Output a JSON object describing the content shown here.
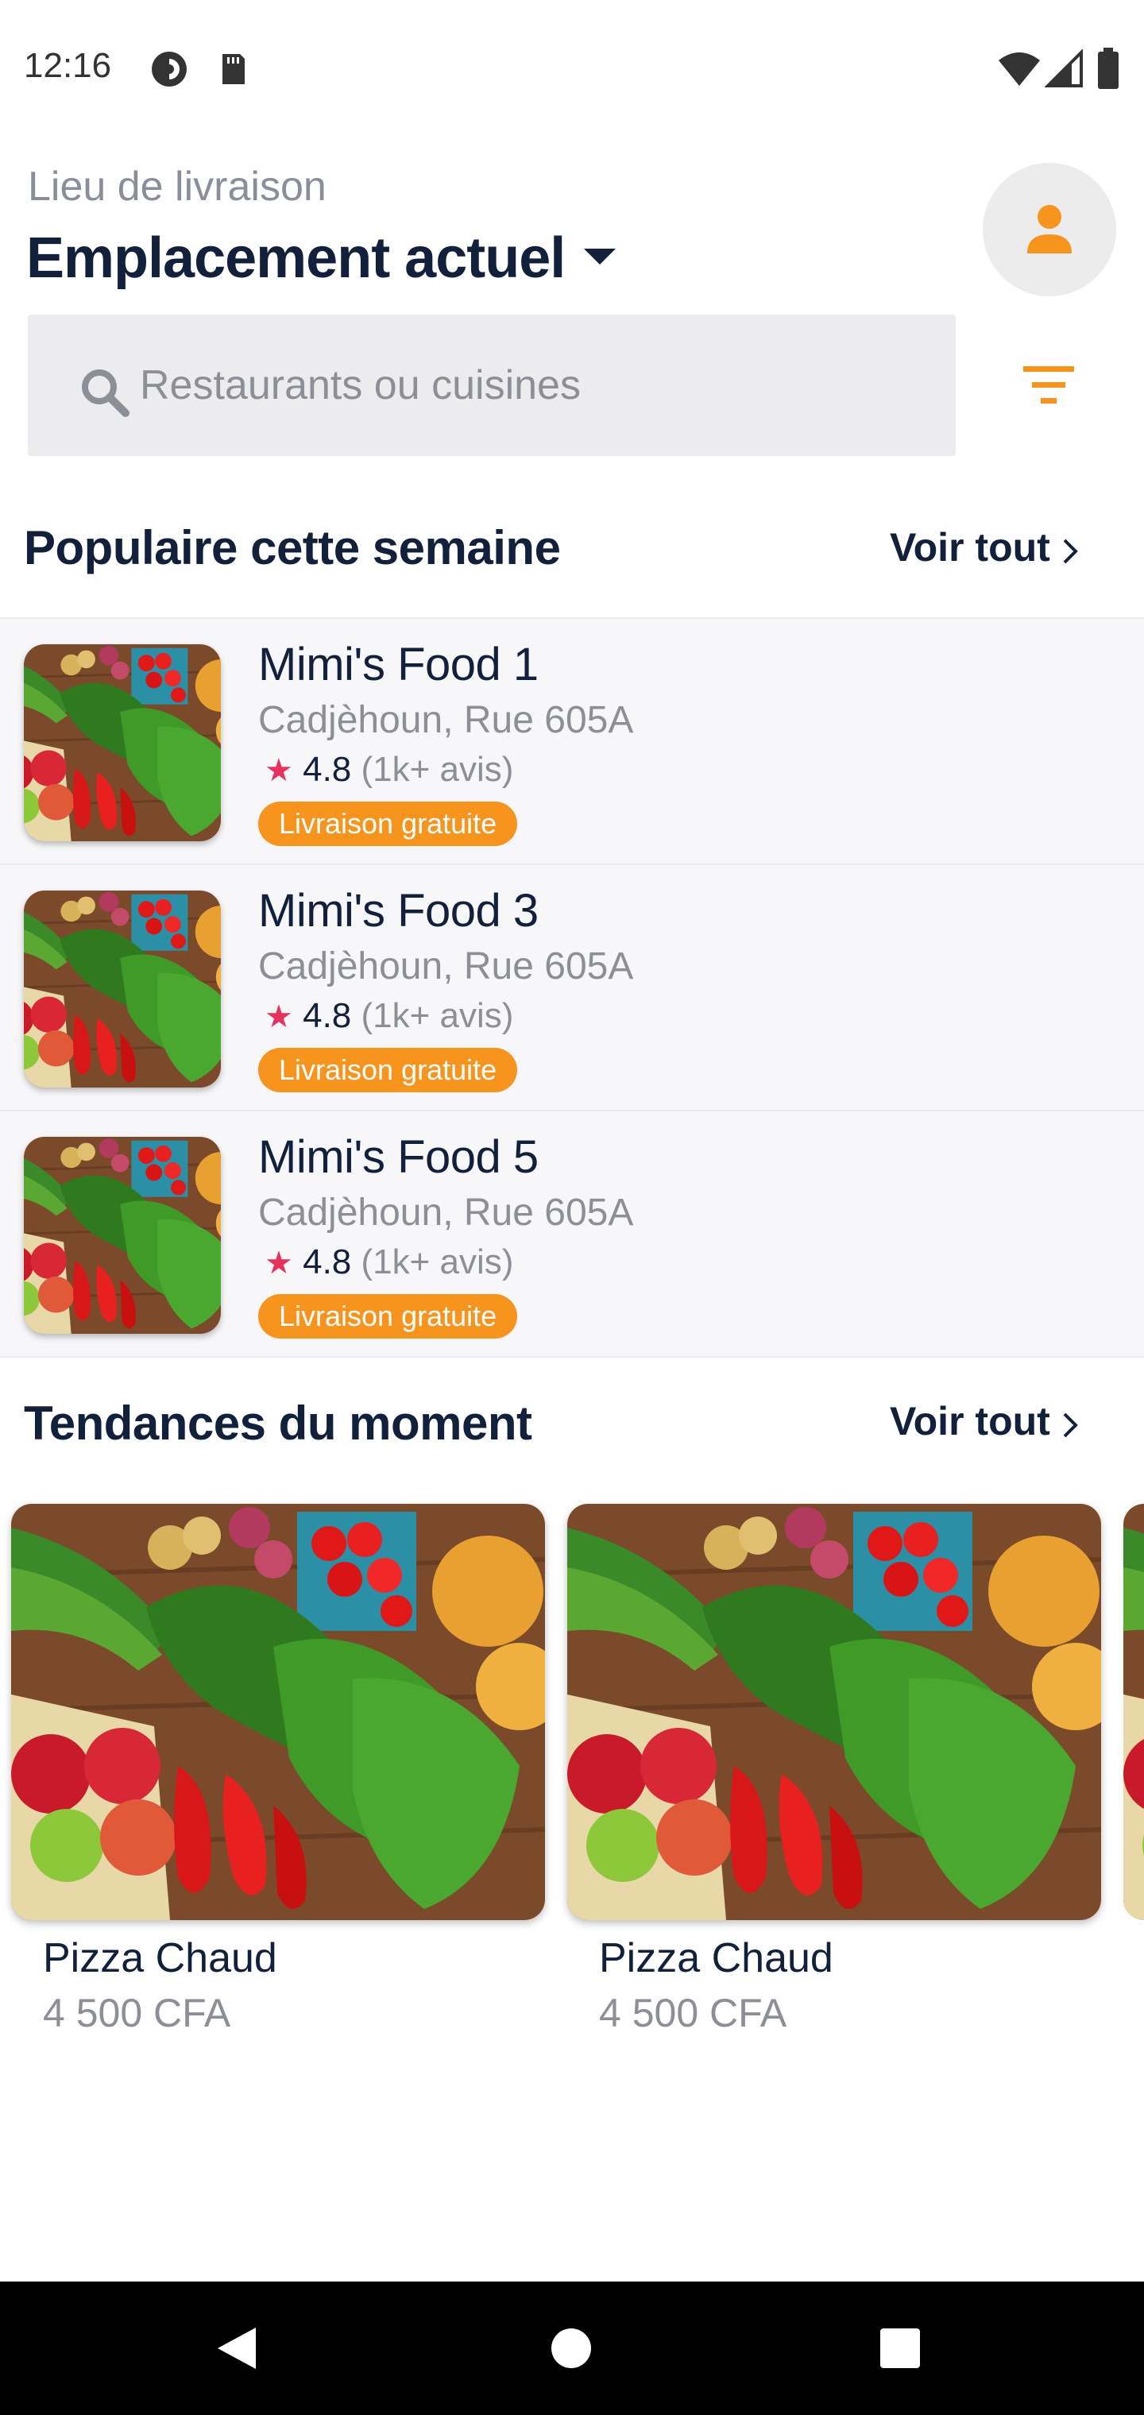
{
  "status_bar": {
    "time": "12:16"
  },
  "header": {
    "location_label": "Lieu de livraison",
    "location_title": "Emplacement actuel",
    "search_placeholder": "Restaurants ou cuisines"
  },
  "popular": {
    "title": "Populaire cette semaine",
    "see_all": "Voir tout",
    "items": [
      {
        "name": "Mimi's Food 1",
        "address": "Cadjèhoun, Rue 605A",
        "rating": "4.8",
        "reviews": "(1k+ avis)",
        "badge": "Livraison gratuite"
      },
      {
        "name": "Mimi's Food 3",
        "address": "Cadjèhoun, Rue 605A",
        "rating": "4.8",
        "reviews": "(1k+ avis)",
        "badge": "Livraison gratuite"
      },
      {
        "name": "Mimi's Food 5",
        "address": "Cadjèhoun, Rue 605A",
        "rating": "4.8",
        "reviews": "(1k+ avis)",
        "badge": "Livraison gratuite"
      }
    ]
  },
  "trending": {
    "title": "Tendances du moment",
    "see_all": "Voir tout",
    "items": [
      {
        "title": "Pizza Chaud",
        "price": "4 500 CFA"
      },
      {
        "title": "Pizza Chaud",
        "price": "4 500 CFA"
      }
    ]
  },
  "colors": {
    "accent": "#f7941d",
    "star": "#e8325e",
    "text": "#13203b",
    "muted": "#8d8f97"
  }
}
